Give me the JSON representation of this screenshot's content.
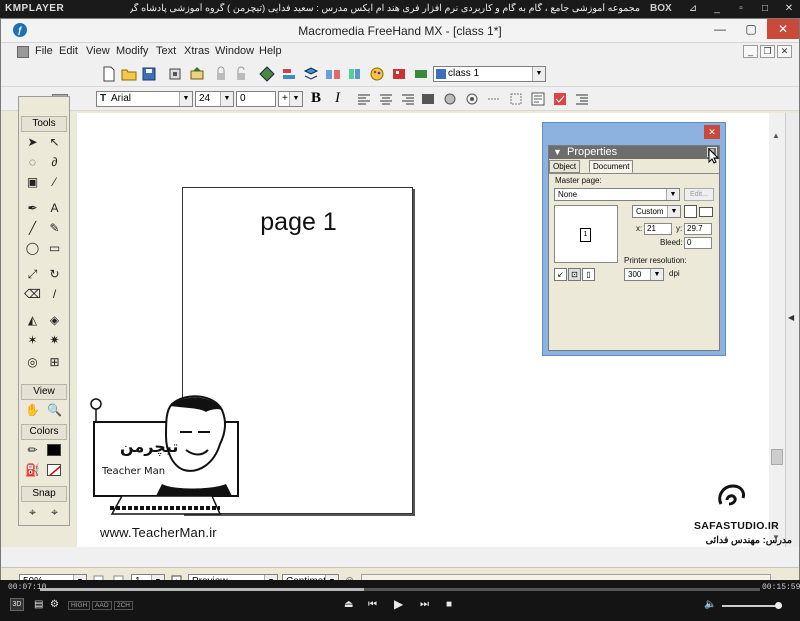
{
  "player": {
    "logo": "KMPLAYER",
    "title": "مجموعه آموزشی جامع ، گام به گام و کاربردی نرم افزار فری هند ام ایکس   مدرس : سعید فدایی (تیچرمن ) گروه آموزشی پادشاه گراهیست ها",
    "box_label": "BOX",
    "current_time": "00:07:10",
    "duration": "00:15:59",
    "progress": 0.45,
    "tags": [
      "HIGH",
      "AAO",
      "2CH"
    ],
    "badge_3d": "3D"
  },
  "app": {
    "title": "Macromedia FreeHand MX - [class 1*]",
    "icon": "freehand-app-icon",
    "menu": [
      "File",
      "Edit",
      "View",
      "Modify",
      "Text",
      "Xtras",
      "Window",
      "Help"
    ]
  },
  "toolbar": {
    "style_select": "class 1",
    "font": "Arial",
    "font_size": "24",
    "leading": "0",
    "leading_mode": "+",
    "bold": "B",
    "italic": "I"
  },
  "tools": {
    "title": "Tools",
    "view": "View",
    "colors": "Colors",
    "snap": "Snap"
  },
  "canvas": {
    "page_text": "page 1"
  },
  "properties": {
    "title": "Properties",
    "tabs": [
      "Object",
      "Document"
    ],
    "master_page_label": "Master page:",
    "master_page_value": "None",
    "edit_button": "Edit...",
    "page_number": "1",
    "size_value": "Custom",
    "x_label": "x:",
    "x_value": "21",
    "y_label": "y:",
    "y_value": "29.7",
    "bleed_label": "Bleed:",
    "bleed_value": "0",
    "resolution_label": "Printer resolution:",
    "resolution_value": "300",
    "resolution_unit": "dpi"
  },
  "status": {
    "zoom": "50%",
    "page": "1",
    "view_mode": "Preview",
    "units": "Centimeters"
  },
  "watermark": {
    "url": "www.TeacherMan.ir",
    "caricature_brand": "تیچرمن",
    "caricature_subtitle": "Teacher Man",
    "studio": "SAFASTUDIO.IR",
    "studio_credit": "مدرس: مهندس فدائی"
  }
}
